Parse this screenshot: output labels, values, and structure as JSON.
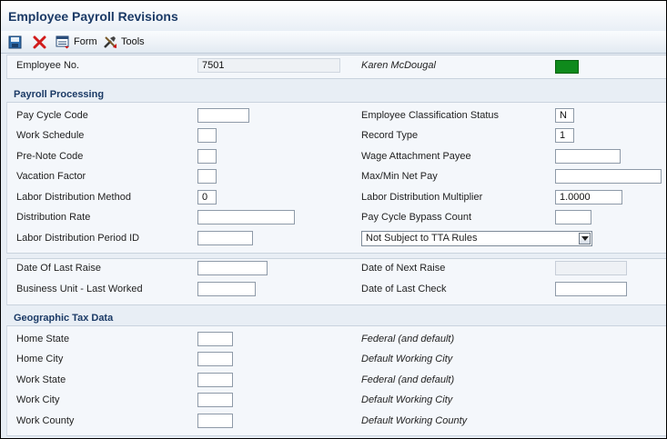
{
  "window": {
    "title": "Employee Payroll Revisions"
  },
  "toolbar": {
    "save_icon": "save-icon",
    "delete_icon": "delete-icon",
    "form_label": "Form",
    "tools_label": "Tools"
  },
  "employee": {
    "label": "Employee No.",
    "value": "7501",
    "name": "Karen McDougal",
    "status_color": "#0f8a1c"
  },
  "payroll_processing": {
    "title": "Payroll Processing",
    "pay_cycle_code": {
      "label": "Pay Cycle Code",
      "value": ""
    },
    "work_schedule": {
      "label": "Work Schedule",
      "value": ""
    },
    "pre_note_code": {
      "label": "Pre-Note Code",
      "value": ""
    },
    "vacation_factor": {
      "label": "Vacation Factor",
      "value": ""
    },
    "labor_distribution_method": {
      "label": "Labor Distribution Method",
      "value": "0"
    },
    "distribution_rate": {
      "label": "Distribution Rate",
      "value": ""
    },
    "labor_distribution_period_id": {
      "label": "Labor Distribution Period ID",
      "value": ""
    },
    "employee_classification_status": {
      "label": "Employee Classification Status",
      "value": "N"
    },
    "record_type": {
      "label": "Record Type",
      "value": "1"
    },
    "wage_attachment_payee": {
      "label": "Wage Attachment Payee",
      "value": ""
    },
    "max_min_net_pay": {
      "label": "Max/Min Net Pay",
      "value": ""
    },
    "labor_distribution_multiplier": {
      "label": "Labor Distribution Multiplier",
      "value": "1.0000"
    },
    "pay_cycle_bypass_count": {
      "label": "Pay Cycle Bypass Count",
      "value": ""
    },
    "tta_rules": {
      "selected": "Not Subject to TTA Rules"
    }
  },
  "dates": {
    "date_of_last_raise": {
      "label": "Date Of Last Raise",
      "value": ""
    },
    "business_unit_last_worked": {
      "label": "Business Unit - Last Worked",
      "value": ""
    },
    "date_of_next_raise": {
      "label": "Date of Next Raise",
      "value": ""
    },
    "date_of_last_check": {
      "label": "Date of Last Check",
      "value": ""
    }
  },
  "geographic_tax": {
    "title": "Geographic Tax Data",
    "rows": [
      {
        "label": "Home State",
        "value": "",
        "description": "Federal (and default)"
      },
      {
        "label": "Home City",
        "value": "",
        "description": "Default Working City"
      },
      {
        "label": "Work State",
        "value": "",
        "description": "Federal (and default)"
      },
      {
        "label": "Work City",
        "value": "",
        "description": "Default Working City"
      },
      {
        "label": "Work County",
        "value": "",
        "description": "Default Working County"
      }
    ]
  }
}
